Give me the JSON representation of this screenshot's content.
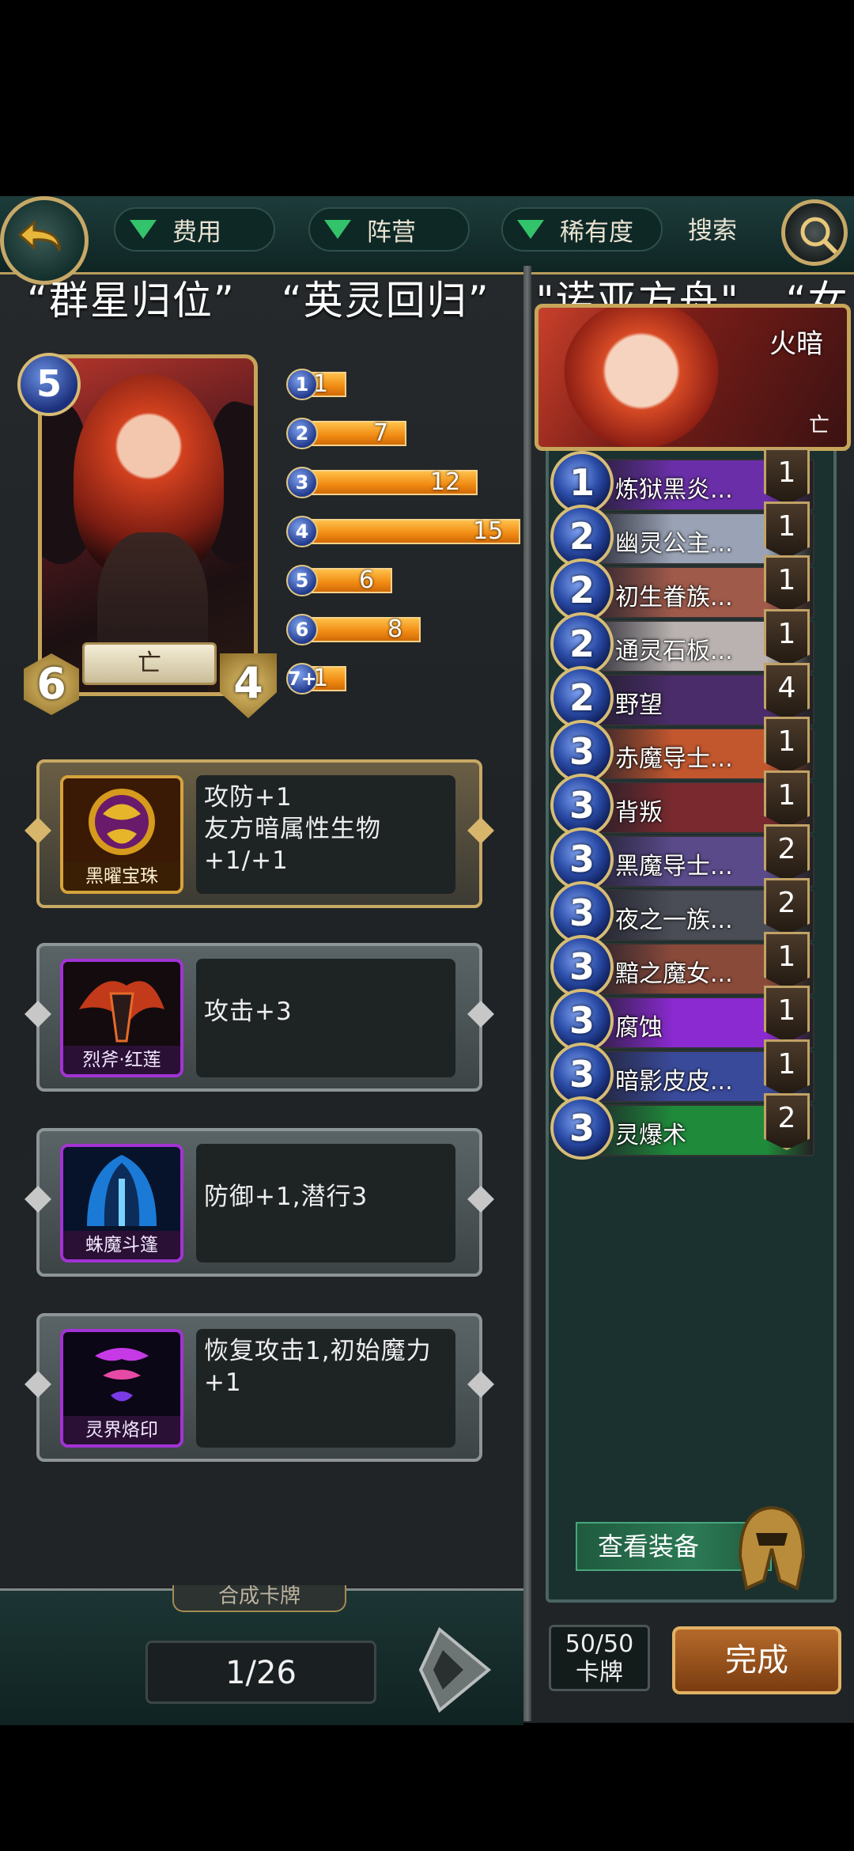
{
  "filters": {
    "cost": "费用",
    "faction": "阵营",
    "rarity": "稀有度",
    "search": "搜索"
  },
  "quotes": [
    "“群星归位”",
    "“英灵回归”",
    "\"诺亚方舟\"",
    "“女"
  ],
  "hero": {
    "cost": "5",
    "attack": "6",
    "health": "4",
    "faction": "亡"
  },
  "cost_curve": [
    {
      "cost": "1",
      "count": "1",
      "value": 1
    },
    {
      "cost": "2",
      "count": "7",
      "value": 7
    },
    {
      "cost": "3",
      "count": "12",
      "value": 12
    },
    {
      "cost": "4",
      "count": "15",
      "value": 15
    },
    {
      "cost": "5",
      "count": "6",
      "value": 6
    },
    {
      "cost": "6",
      "count": "8",
      "value": 8
    },
    {
      "cost": "7+",
      "count": "1",
      "value": 1
    }
  ],
  "abilities": [
    {
      "label": "黑曜宝珠",
      "desc": "攻防+1\n友方暗属性生物+1/+1"
    },
    {
      "label": "烈斧·红莲",
      "desc": "攻击+3"
    },
    {
      "label": "蛛魔斗篷",
      "desc": "防御+1,潜行3"
    },
    {
      "label": "灵界烙印",
      "desc": "恢复攻击1,初始魔力+1"
    }
  ],
  "compose_tab": "合成卡牌",
  "page": "1/26",
  "deck": {
    "title": "火暗",
    "faction": "亡",
    "cards": [
      {
        "cost": "1",
        "name": "炼狱黑炎...",
        "count": "1",
        "color": "#6a2fa8"
      },
      {
        "cost": "2",
        "name": "幽灵公主...",
        "count": "1",
        "color": "#9aa3b5"
      },
      {
        "cost": "2",
        "name": "初生眷族...",
        "count": "1",
        "color": "#a05a4a"
      },
      {
        "cost": "2",
        "name": "通灵石板...",
        "count": "1",
        "color": "#b9b2b0"
      },
      {
        "cost": "2",
        "name": "野望",
        "count": "4",
        "color": "#4b2c6a"
      },
      {
        "cost": "3",
        "name": "赤魔导士...",
        "count": "1",
        "color": "#c2572e"
      },
      {
        "cost": "3",
        "name": "背叛",
        "count": "1",
        "color": "#7a2a2e"
      },
      {
        "cost": "3",
        "name": "黑魔导士...",
        "count": "2",
        "color": "#5a4a8a"
      },
      {
        "cost": "3",
        "name": "夜之一族...",
        "count": "2",
        "color": "#4a4d56"
      },
      {
        "cost": "3",
        "name": "黯之魔女...",
        "count": "1",
        "color": "#8a4a3a"
      },
      {
        "cost": "3",
        "name": "腐蚀",
        "count": "1",
        "color": "#8a2ad0"
      },
      {
        "cost": "3",
        "name": "暗影皮皮...",
        "count": "1",
        "color": "#3a4a9a"
      },
      {
        "cost": "3",
        "name": "灵爆术",
        "count": "2",
        "color": "#1f8a3a"
      }
    ]
  },
  "view_equipment": "查看装备",
  "card_total": {
    "count": "50/50",
    "label": "卡牌"
  },
  "done": "完成"
}
